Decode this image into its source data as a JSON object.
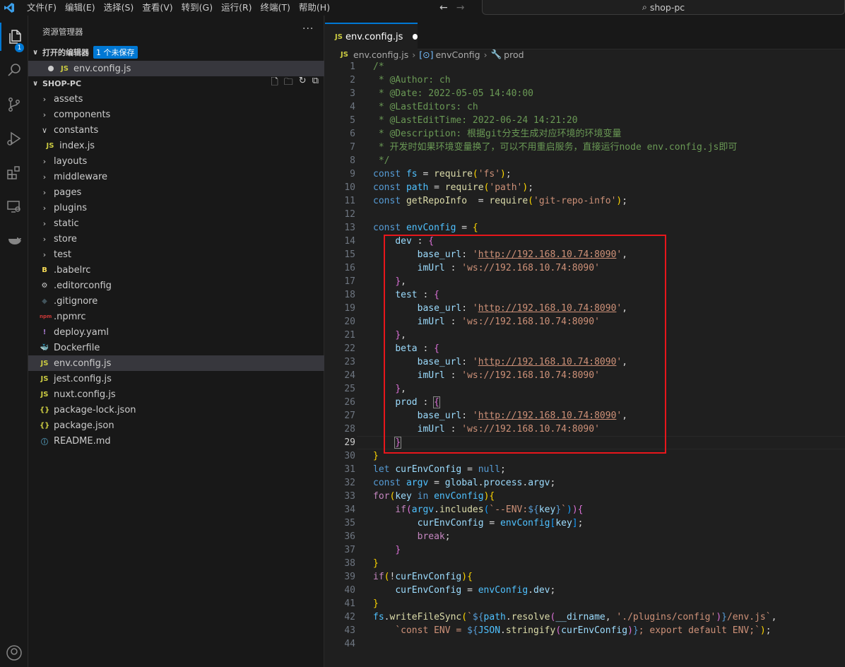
{
  "titlebar": {
    "menus": [
      "文件(F)",
      "编辑(E)",
      "选择(S)",
      "查看(V)",
      "转到(G)",
      "运行(R)",
      "终端(T)",
      "帮助(H)"
    ],
    "search": "shop-pc"
  },
  "activity_badge": "1",
  "sidebar": {
    "title": "资源管理器",
    "open_editors_label": "打开的编辑器",
    "unsaved_label": "1 个未保存",
    "open_file": "env.config.js",
    "project_label": "SHOP-PC",
    "tree": [
      {
        "label": "assets",
        "kind": "folder",
        "indent": 0
      },
      {
        "label": "components",
        "kind": "folder",
        "indent": 0
      },
      {
        "label": "constants",
        "kind": "folder-open",
        "indent": 0
      },
      {
        "label": "index.js",
        "kind": "js",
        "indent": 1
      },
      {
        "label": "layouts",
        "kind": "folder",
        "indent": 0
      },
      {
        "label": "middleware",
        "kind": "folder",
        "indent": 0
      },
      {
        "label": "pages",
        "kind": "folder",
        "indent": 0
      },
      {
        "label": "plugins",
        "kind": "folder",
        "indent": 0
      },
      {
        "label": "static",
        "kind": "folder",
        "indent": 0
      },
      {
        "label": "store",
        "kind": "folder",
        "indent": 0
      },
      {
        "label": "test",
        "kind": "folder",
        "indent": 0
      },
      {
        "label": ".babelrc",
        "kind": "babel",
        "indent": 0
      },
      {
        "label": ".editorconfig",
        "kind": "editorconfig",
        "indent": 0
      },
      {
        "label": ".gitignore",
        "kind": "git",
        "indent": 0
      },
      {
        "label": ".npmrc",
        "kind": "npm",
        "indent": 0
      },
      {
        "label": "deploy.yaml",
        "kind": "yaml",
        "indent": 0
      },
      {
        "label": "Dockerfile",
        "kind": "docker",
        "indent": 0
      },
      {
        "label": "env.config.js",
        "kind": "js",
        "indent": 0,
        "selected": true
      },
      {
        "label": "jest.config.js",
        "kind": "js",
        "indent": 0
      },
      {
        "label": "nuxt.config.js",
        "kind": "js",
        "indent": 0
      },
      {
        "label": "package-lock.json",
        "kind": "json",
        "indent": 0
      },
      {
        "label": "package.json",
        "kind": "json",
        "indent": 0
      },
      {
        "label": "README.md",
        "kind": "md",
        "indent": 0
      }
    ]
  },
  "editor": {
    "tab_label": "env.config.js",
    "breadcrumb": [
      "env.config.js",
      "envConfig",
      "prod"
    ],
    "current_line": 29
  },
  "colors": {
    "accent": "#0078d4",
    "highlight_box": "#e8161b"
  }
}
